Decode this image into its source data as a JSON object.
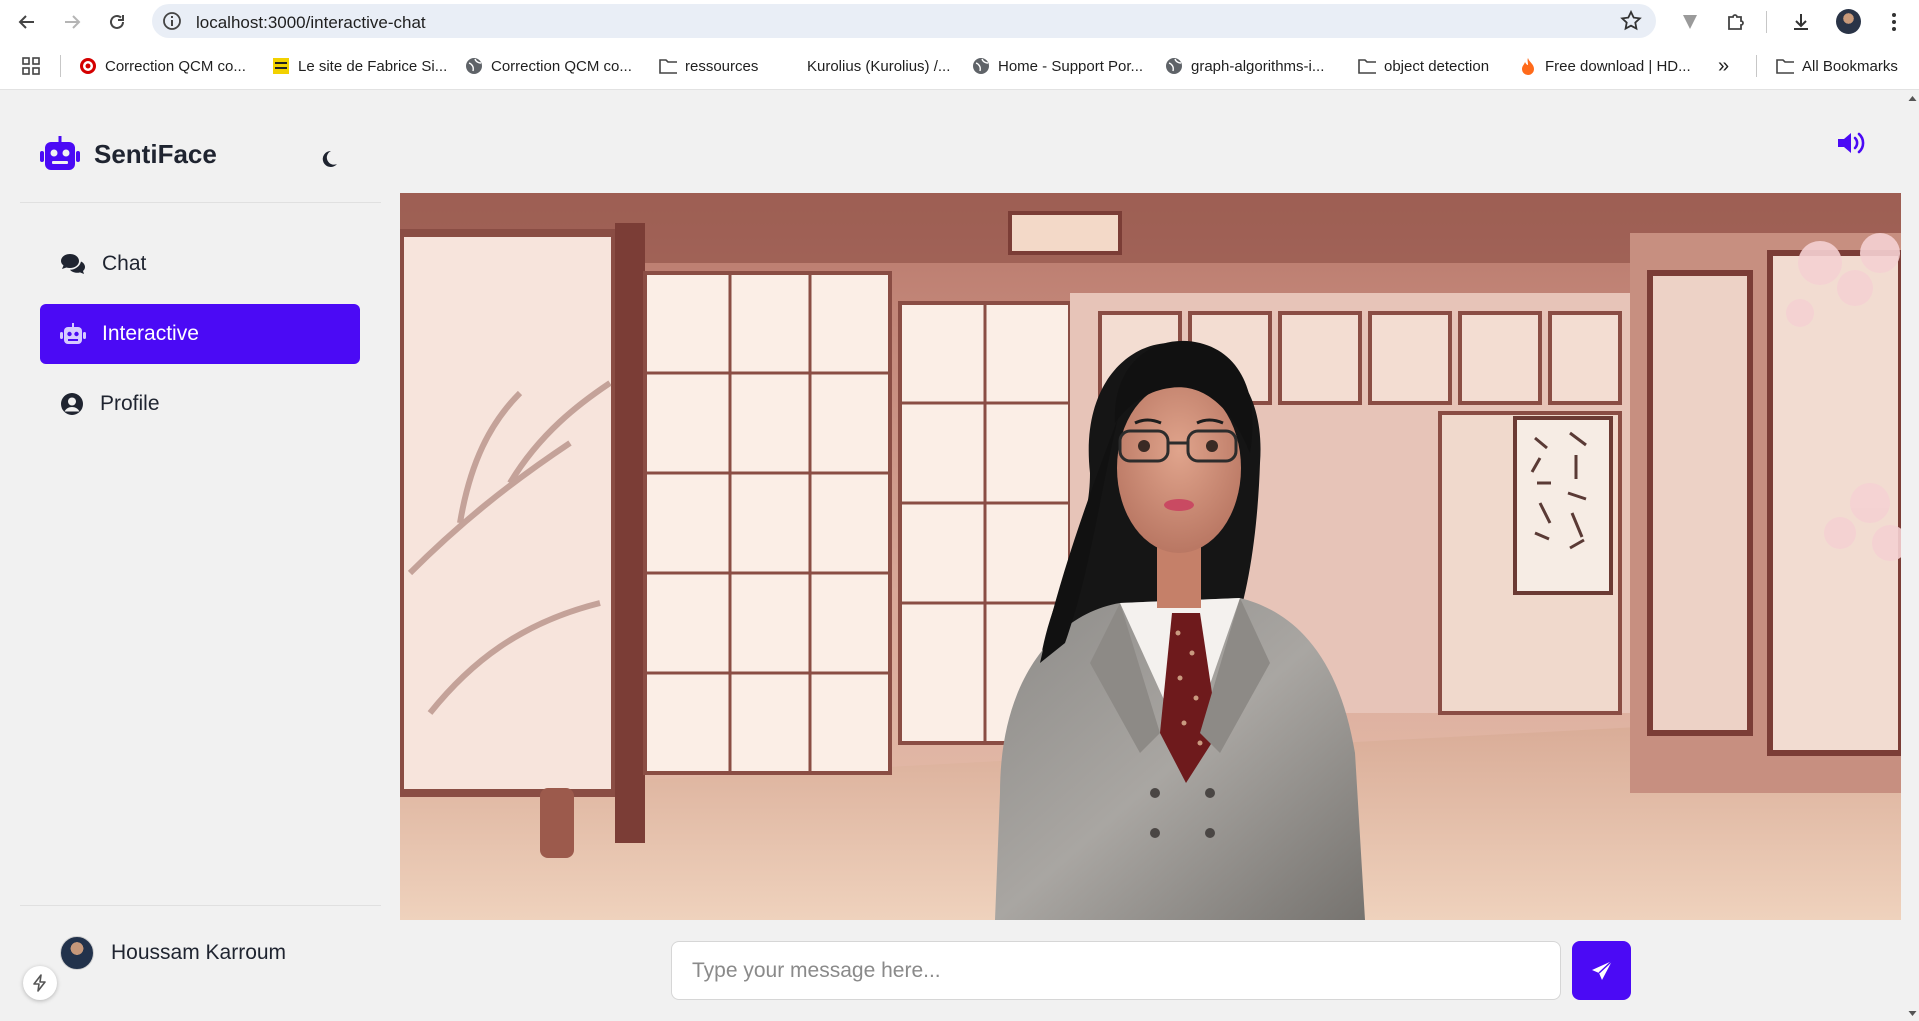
{
  "browser": {
    "url": "localhost:3000/interactive-chat",
    "bookmarks": [
      "Correction QCM co...",
      "Le site de Fabrice Si...",
      "Correction QCM co...",
      "ressources",
      "Kurolius (Kurolius) /...",
      "Home - Support Por...",
      "graph-algorithms-i...",
      "object detection",
      "Free download | HD..."
    ],
    "overflow": "»",
    "all_bookmarks": "All Bookmarks"
  },
  "app": {
    "name": "SentiFace",
    "accent": "#4b0af5",
    "nav": [
      {
        "label": "Chat",
        "icon": "comments-icon",
        "active": false
      },
      {
        "label": "Interactive",
        "icon": "robot-icon",
        "active": true
      },
      {
        "label": "Profile",
        "icon": "user-circle-icon",
        "active": false
      }
    ],
    "user": {
      "name": "Houssam Karroum"
    }
  },
  "chat": {
    "placeholder": "Type your message here...",
    "send_icon": "paper-plane-icon",
    "sound_icon": "volume-up-icon"
  }
}
